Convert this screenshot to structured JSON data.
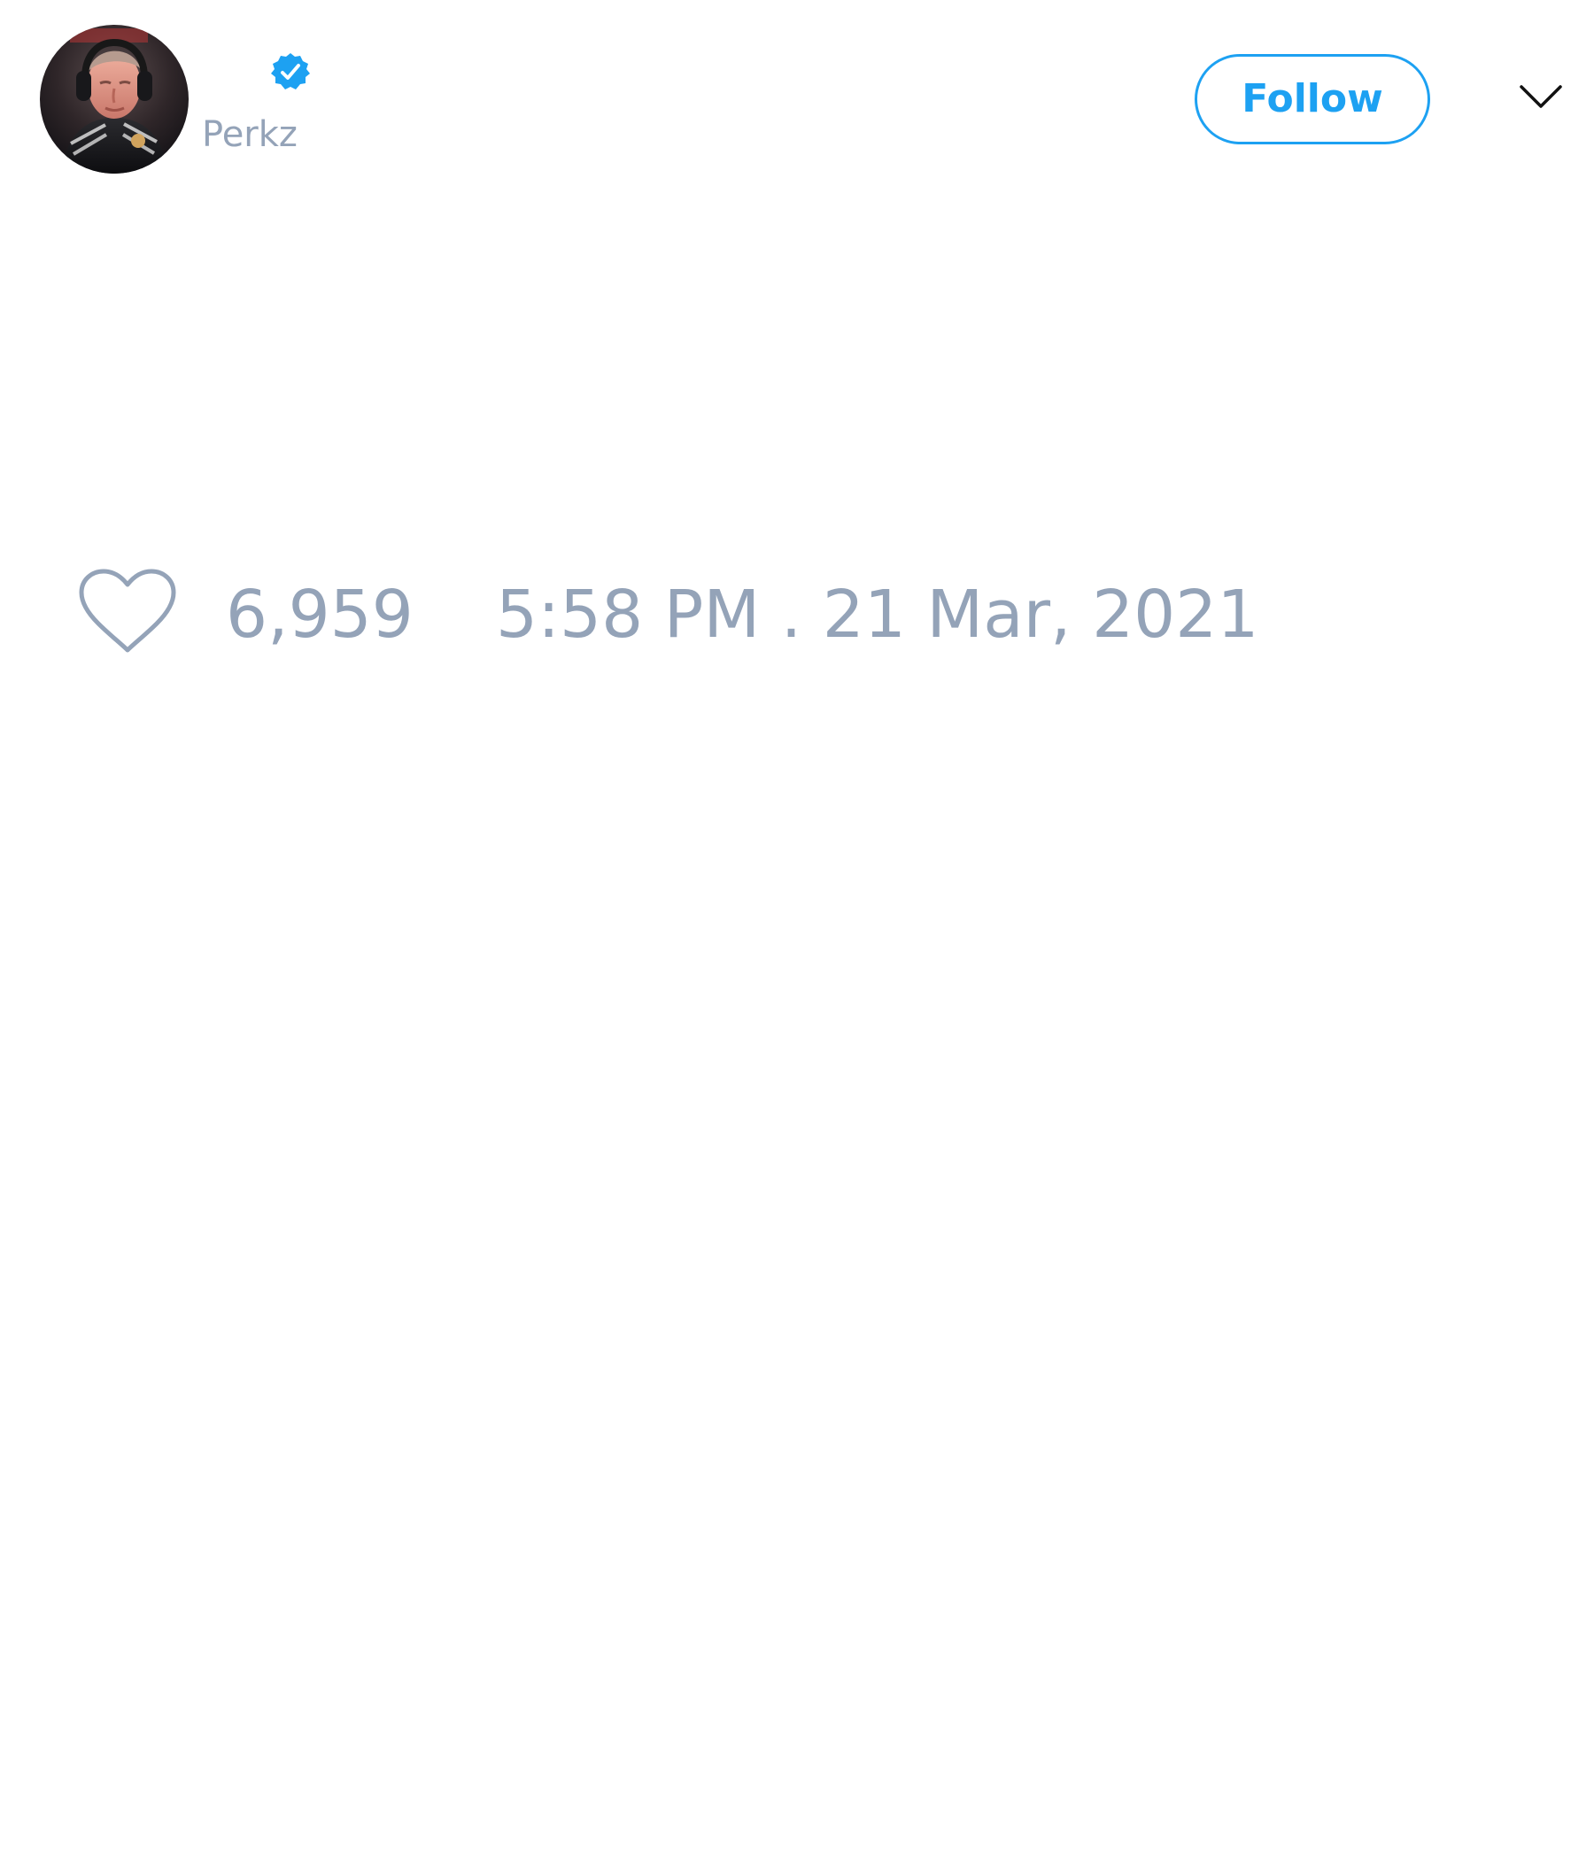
{
  "tweet": {
    "author": {
      "display_name": "",
      "handle": "Perkz",
      "verified": true,
      "avatar": "avatar-photo"
    },
    "follow_label": "Follow",
    "menu_icon": "chevron-down-icon",
    "like_icon": "heart-icon",
    "like_count": "6,959",
    "timestamp": "5:58 PM . 21 Mar, 2021"
  },
  "colors": {
    "accent": "#1da1f2",
    "muted_text": "#94a3b8",
    "background": "#ffffff",
    "icon_dark": "#111111"
  }
}
